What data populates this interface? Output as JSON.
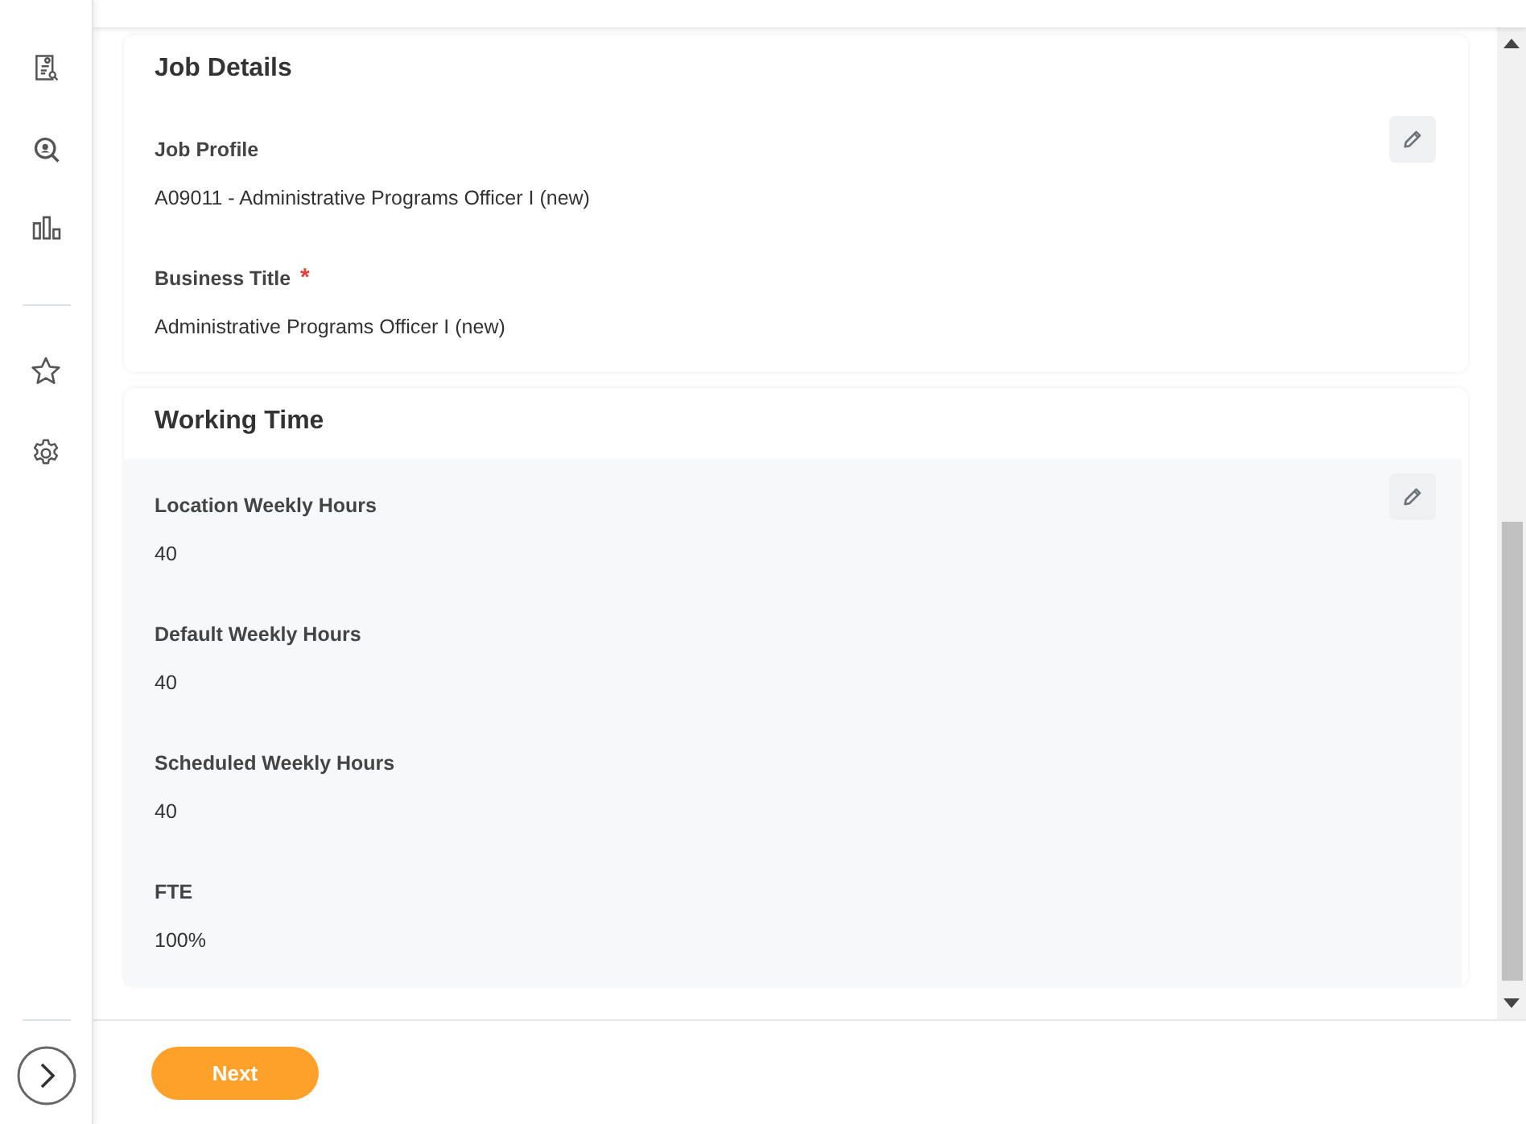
{
  "sections": [
    {
      "title": "Job Details",
      "editable": true,
      "highlighted": false,
      "fields": [
        {
          "label": "Job Profile",
          "value": "A09011 - Administrative Programs Officer I (new)"
        },
        {
          "label": "Business Title",
          "required_mark": "*",
          "value": "Administrative Programs Officer I (new)"
        }
      ]
    },
    {
      "title": "Working Time",
      "editable": true,
      "highlighted": true,
      "fields": [
        {
          "label": "Location Weekly Hours",
          "value": "40"
        },
        {
          "label": "Default Weekly Hours",
          "value": "40"
        },
        {
          "label": "Scheduled Weekly Hours",
          "value": "40"
        },
        {
          "label": "FTE",
          "value": "100%"
        }
      ]
    }
  ],
  "footer": {
    "primary_button": "Next"
  }
}
